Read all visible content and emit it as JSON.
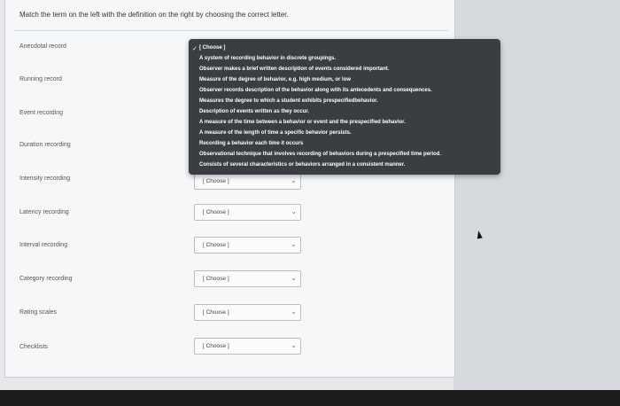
{
  "instructions": "Match the term on the left with the definition on the right by choosing the correct letter.",
  "terms": [
    "Anecdotal record",
    "Running record",
    "Event recording",
    "Duration recording",
    "Intensity recording",
    "Latency recording",
    "Interval recording",
    "Category recording",
    "Rating scales",
    "Checklists"
  ],
  "select_placeholder": "[ Choose ]",
  "chevron_glyph": "⌄",
  "dropdown": {
    "check_glyph": "✓",
    "options": [
      "[ Choose ]",
      "A system of recording behavior in discrete groupings.",
      "Observer makes a brief written description of events considered important.",
      "Measure of the degree of behavior, e.g. high medium, or low",
      "Observer records description of the behavior along with its antecedents and consequences.",
      "Measures the degree to which a student exhibits prespecifiedbehavior.",
      "Description of events written as they occur.",
      "A measure of the time between a behavior or event and the prespecified behavior.",
      "A measure of the length of time a specific behavior persists.",
      "Recording a behavior each time it occurs",
      "Observational technique that involves recording of behaviors during a prespecified time period.",
      "Consists of several characteristics or behaviors arranged in a consistent manner."
    ]
  }
}
